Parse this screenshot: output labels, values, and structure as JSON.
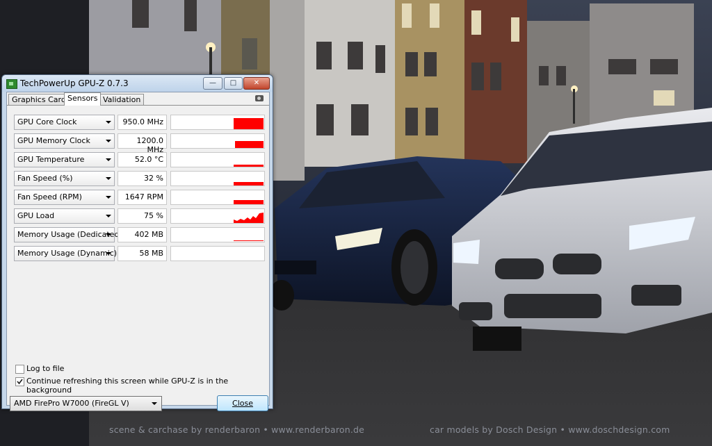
{
  "window": {
    "title": "TechPowerUp GPU-Z 0.7.3",
    "controls": {
      "minimize": "—",
      "maximize": "□",
      "close": "✕"
    }
  },
  "tabs": [
    {
      "label": "Graphics Card",
      "active": false
    },
    {
      "label": "Sensors",
      "active": true
    },
    {
      "label": "Validation",
      "active": false
    }
  ],
  "sensors": [
    {
      "name": "GPU Core Clock",
      "value": "950.0 MHz"
    },
    {
      "name": "GPU Memory Clock",
      "value": "1200.0 MHz"
    },
    {
      "name": "GPU Temperature",
      "value": "52.0 °C"
    },
    {
      "name": "Fan Speed (%)",
      "value": "32 %"
    },
    {
      "name": "Fan Speed (RPM)",
      "value": "1647 RPM"
    },
    {
      "name": "GPU Load",
      "value": "75 %"
    },
    {
      "name": "Memory Usage (Dedicated)",
      "value": "402 MB"
    },
    {
      "name": "Memory Usage (Dynamic)",
      "value": "58 MB"
    }
  ],
  "options": {
    "log_to_file": {
      "label": "Log to file",
      "checked": false
    },
    "continue_refresh": {
      "label": "Continue refreshing this screen while GPU-Z is in the background",
      "checked": true
    }
  },
  "gpu_select": {
    "selected": "AMD FirePro W7000 (FireGL V)"
  },
  "close_label": "Close",
  "credits": {
    "left": "scene & carchase by renderbaron • www.renderbaron.de",
    "right": "car models by Dosch Design • www.doschdesign.com"
  },
  "colors": {
    "graph": "#ff0000",
    "title_bar": "#c5d7ea"
  }
}
